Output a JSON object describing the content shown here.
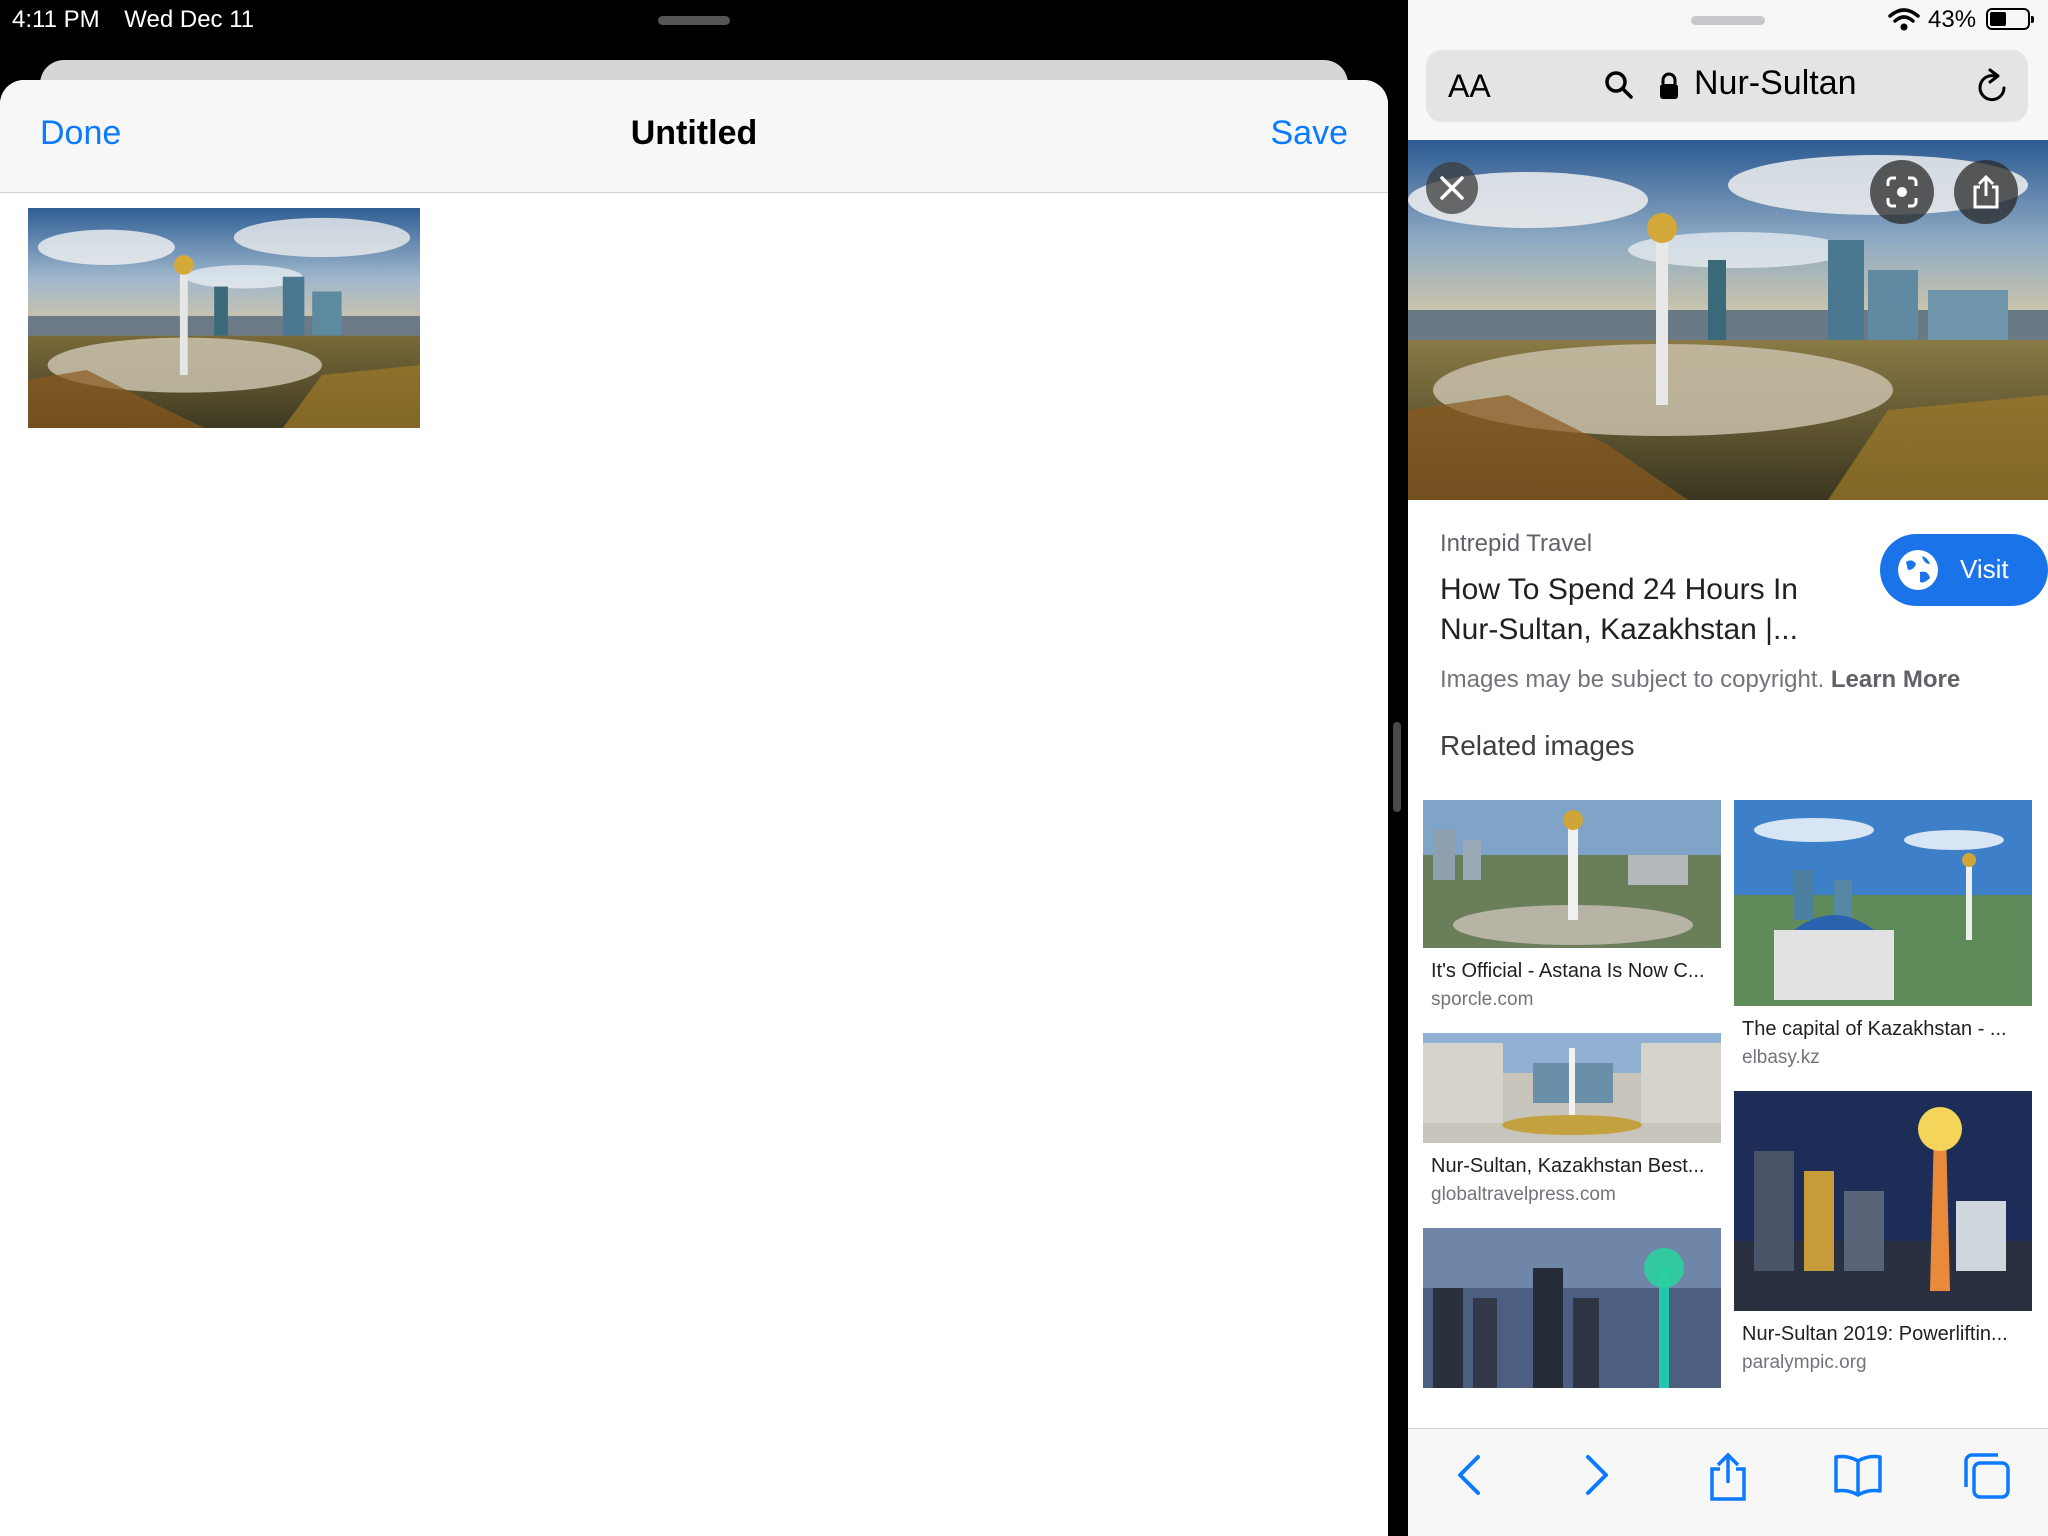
{
  "status": {
    "time": "4:11 PM",
    "date": "Wed Dec 11",
    "battery": "43%"
  },
  "editor": {
    "done_label": "Done",
    "title": "Untitled",
    "save_label": "Save"
  },
  "browser": {
    "aa_label": "AA",
    "url_text": "Nur-Sultan",
    "result": {
      "source": "Intrepid Travel",
      "title": "How To Spend 24 Hours In Nur-Sultan, Kazakhstan |...",
      "visit_label": "Visit",
      "copyright_text": "Images may be subject to copyright.",
      "learn_more": "Learn More"
    },
    "related_heading": "Related images",
    "related": [
      {
        "caption": "It's Official - Astana Is Now C...",
        "domain": "sporcle.com"
      },
      {
        "caption": "The capital of Kazakhstan - ...",
        "domain": "elbasy.kz"
      },
      {
        "caption": "Nur-Sultan, Kazakhstan Best...",
        "domain": "globaltravelpress.com"
      },
      {
        "caption": "Nur-Sultan 2019: Powerliftin...",
        "domain": "paralympic.org"
      }
    ]
  },
  "colors": {
    "ios_blue": "#0a7aff",
    "google_blue": "#1a73e8"
  },
  "icons": [
    "wifi-icon",
    "battery-icon",
    "search-icon",
    "lock-icon",
    "reload-icon",
    "close-icon",
    "lens-icon",
    "share-icon",
    "globe-icon",
    "back-icon",
    "forward-icon",
    "bookmarks-icon",
    "tabs-icon"
  ]
}
